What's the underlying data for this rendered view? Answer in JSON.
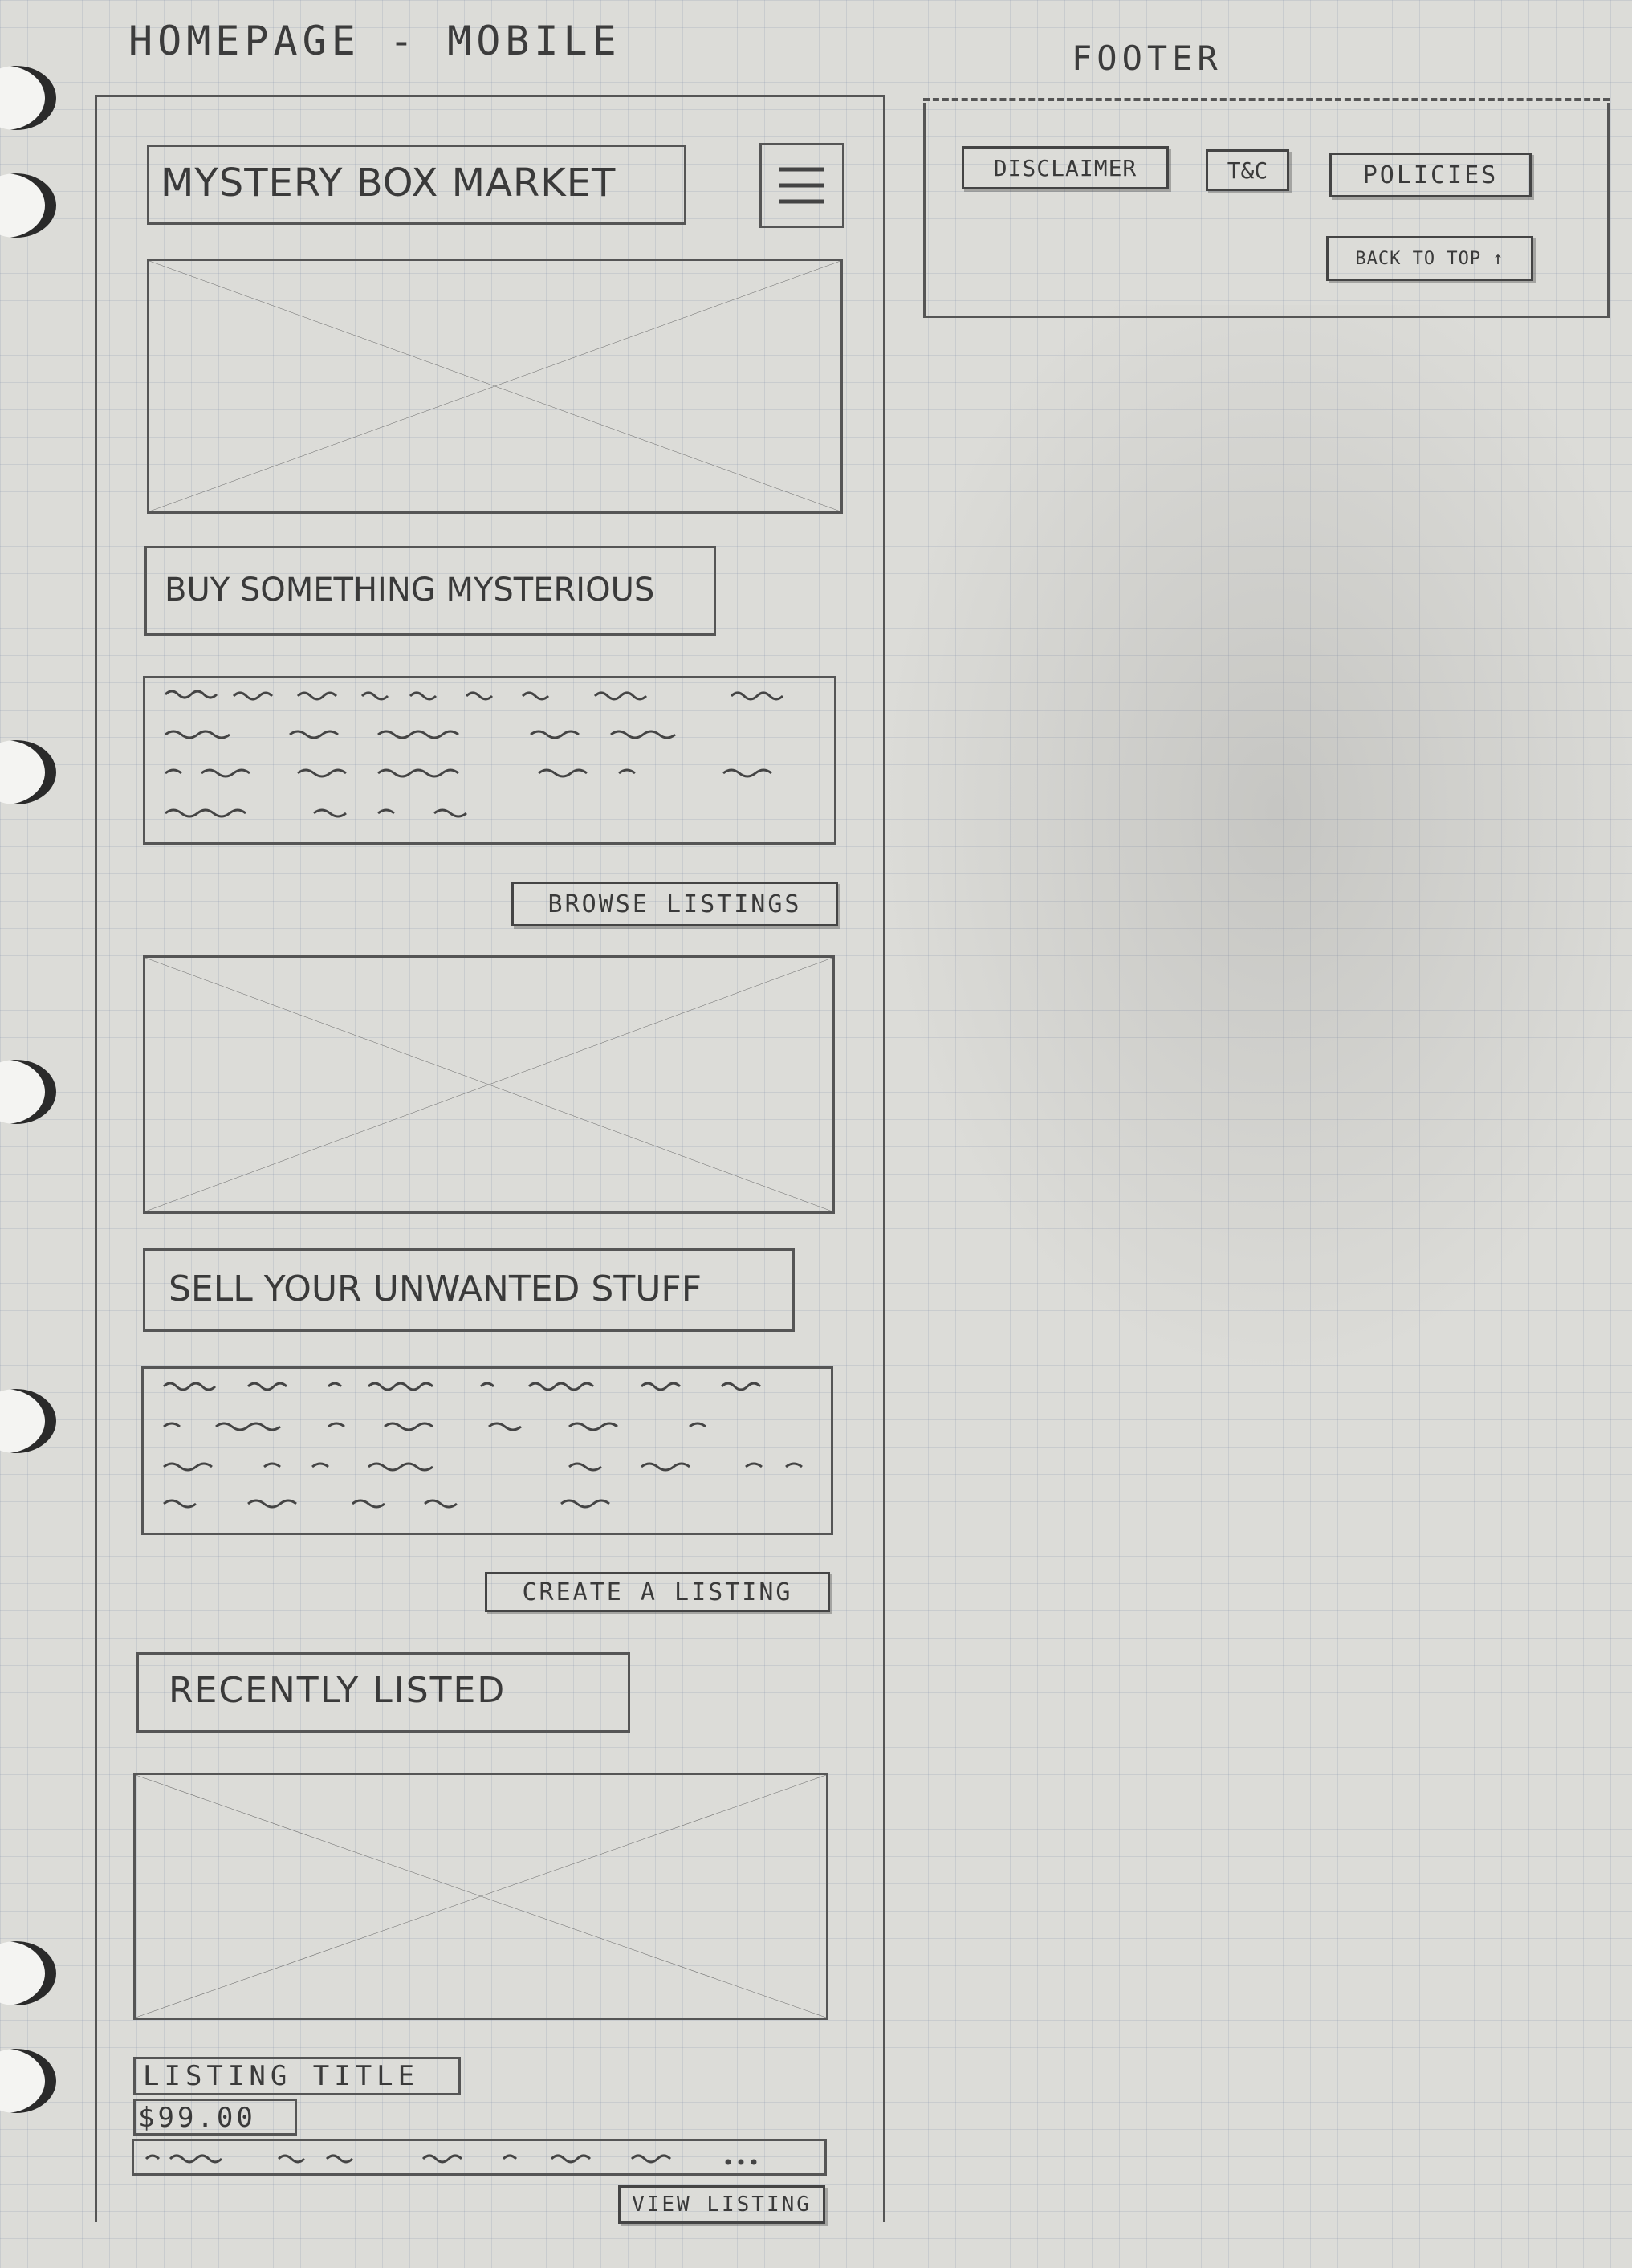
{
  "titles": {
    "page": "HOMEPAGE - MOBILE",
    "footer": "FOOTER"
  },
  "header": {
    "logo": "MYSTERY BOX MARKET",
    "menu_icon": "hamburger-menu-icon"
  },
  "sections": {
    "buy_heading": "BUY SOMETHING MYSTERIOUS",
    "browse_button": "BROWSE LISTINGS",
    "sell_heading": "SELL YOUR UNWANTED STUFF",
    "create_button": "CREATE A LISTING",
    "recent_heading": "RECENTLY LISTED"
  },
  "listing": {
    "title": "LISTING TITLE",
    "price": "$99.00",
    "view_button": "VIEW LISTING"
  },
  "footer": {
    "disclaimer": "DISCLAIMER",
    "tc": "T&C",
    "policies": "POLICIES",
    "back_to_top": "BACK TO TOP ↑"
  },
  "colors": {
    "paper": "#dcdcd8",
    "pencil": "#555555"
  }
}
